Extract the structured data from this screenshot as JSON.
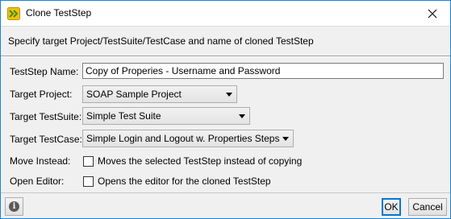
{
  "window": {
    "title": "Clone TestStep",
    "close_glyph": "✕"
  },
  "header": {
    "description": "Specify target Project/TestSuite/TestCase and name of cloned TestStep"
  },
  "form": {
    "teststep_name": {
      "label": "TestStep Name:",
      "value": "Copy of Properies - Username and Password"
    },
    "target_project": {
      "label": "Target Project:",
      "value": "SOAP Sample Project"
    },
    "target_testsuite": {
      "label": "Target TestSuite:",
      "value": "Simple Test Suite"
    },
    "target_testcase": {
      "label": "Target TestCase:",
      "value": "Simple Login and Logout w. Properties Steps"
    },
    "move_instead": {
      "label": "Move Instead:",
      "checkbox_text": "Moves the selected TestStep instead of copying",
      "checked": false
    },
    "open_editor": {
      "label": "Open Editor:",
      "checkbox_text": "Opens the editor for the cloned TestStep",
      "checked": false
    }
  },
  "footer": {
    "info_glyph": "i",
    "ok_label": "OK",
    "cancel_label": "Cancel"
  },
  "colors": {
    "window_border": "#1883d7",
    "panel_bg": "#f0f0f0",
    "icon_yellow": "#f2c10a",
    "icon_green": "#3c8c1e"
  },
  "icons": {
    "app": "soapui-teststep-icon",
    "close": "close-icon",
    "info": "info-icon",
    "dropdown": "chevron-down-icon"
  }
}
